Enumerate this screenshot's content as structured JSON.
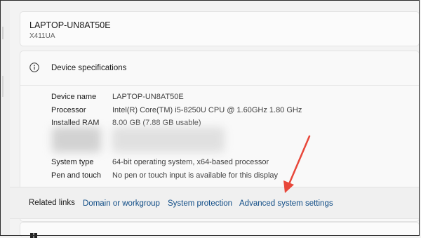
{
  "device": {
    "name": "LAPTOP-UN8AT50E",
    "model": "X411UA"
  },
  "specs": {
    "title": "Device specifications",
    "rows": [
      {
        "label": "Device name",
        "value": "LAPTOP-UN8AT50E"
      },
      {
        "label": "Processor",
        "value": "Intel(R) Core(TM) i5-8250U CPU @ 1.60GHz   1.80 GHz"
      },
      {
        "label": "Installed RAM",
        "value": "8.00 GB (7.88 GB usable)"
      },
      {
        "label": "System type",
        "value": "64-bit operating system, x64-based processor"
      },
      {
        "label": "Pen and touch",
        "value": "No pen or touch input is available for this display"
      }
    ]
  },
  "related": {
    "label": "Related links",
    "links": [
      "Domain or workgroup",
      "System protection",
      "Advanced system settings"
    ]
  },
  "colors": {
    "link": "#0f4c86",
    "arrow": "#e8473a"
  },
  "icons": {
    "info": "info-icon",
    "windows": "windows-logo-icon"
  }
}
